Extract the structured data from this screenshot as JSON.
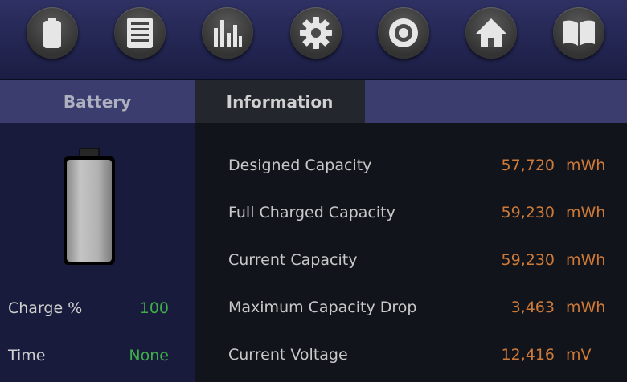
{
  "toolbar": {
    "buttons": [
      {
        "icon": "battery-icon"
      },
      {
        "icon": "list-icon"
      },
      {
        "icon": "bar-chart-icon"
      },
      {
        "icon": "gear-icon"
      },
      {
        "icon": "target-icon"
      },
      {
        "icon": "home-icon"
      },
      {
        "icon": "book-icon"
      }
    ]
  },
  "tabs": {
    "battery": "Battery",
    "information": "Information"
  },
  "battery_panel": {
    "charge_label": "Charge %",
    "charge_value": "100",
    "time_label": "Time",
    "time_value": "None"
  },
  "info": {
    "rows": [
      {
        "label": "Designed Capacity",
        "value": "57,720",
        "unit": "mWh"
      },
      {
        "label": "Full Charged Capacity",
        "value": "59,230",
        "unit": "mWh"
      },
      {
        "label": "Current Capacity",
        "value": "59,230",
        "unit": "mWh"
      },
      {
        "label": "Maximum Capacity Drop",
        "value": "3,463",
        "unit": "mWh"
      },
      {
        "label": "Current Voltage",
        "value": "12,416",
        "unit": "mV"
      }
    ]
  },
  "colors": {
    "accent_value": "#d07a38",
    "status_green": "#3fae49",
    "toolbar_bg": "#2e3163",
    "tab_bg": "#3a3d6e"
  }
}
